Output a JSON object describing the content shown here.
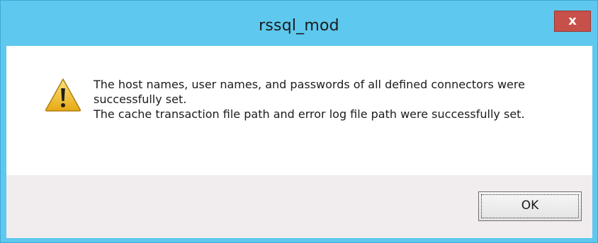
{
  "window": {
    "title": "rssql_mod",
    "close_label": "x"
  },
  "message": {
    "icon": "warning-icon",
    "line1": "The host names, user names, and passwords of all defined connectors were successfully set.",
    "line2": "The cache transaction file path and error log file path were successfully set."
  },
  "buttons": {
    "ok_label": "OK"
  },
  "colors": {
    "titlebar": "#5ec8ee",
    "close_button": "#c7504a",
    "footer": "#f1ecee",
    "warning_fill": "#f2c230"
  }
}
